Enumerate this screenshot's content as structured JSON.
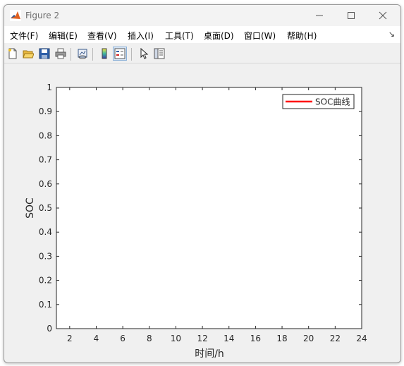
{
  "window": {
    "title": "Figure 2"
  },
  "menu": [
    {
      "label": "文件(F)"
    },
    {
      "label": "编辑(E)"
    },
    {
      "label": "查看(V)"
    },
    {
      "label": "插入(I)"
    },
    {
      "label": "工具(T)"
    },
    {
      "label": "桌面(D)"
    },
    {
      "label": "窗口(W)"
    },
    {
      "label": "帮助(H)"
    }
  ],
  "toolbar": [
    {
      "icon": "new-figure-icon"
    },
    {
      "icon": "open-file-icon"
    },
    {
      "icon": "save-icon"
    },
    {
      "icon": "print-icon"
    },
    {
      "icon": "link-plot-icon"
    },
    {
      "icon": "insert-colorbar-icon"
    },
    {
      "icon": "insert-legend-icon"
    },
    {
      "icon": "edit-plot-icon"
    },
    {
      "icon": "property-inspector-icon"
    }
  ],
  "chart_data": {
    "type": "line",
    "xlabel": "时间/h",
    "ylabel": "SOC",
    "xlim": [
      1,
      24
    ],
    "ylim": [
      0,
      1
    ],
    "xticks": [
      2,
      4,
      6,
      8,
      10,
      12,
      14,
      16,
      18,
      20,
      22,
      24
    ],
    "yticks": [
      0,
      0.1,
      0.2,
      0.3,
      0.4,
      0.5,
      0.6,
      0.7,
      0.8,
      0.9,
      1
    ],
    "series": [
      {
        "name": "SOC曲线",
        "color": "#ff0000",
        "x": [],
        "y": []
      }
    ],
    "legend": "top-right",
    "grid": false
  }
}
